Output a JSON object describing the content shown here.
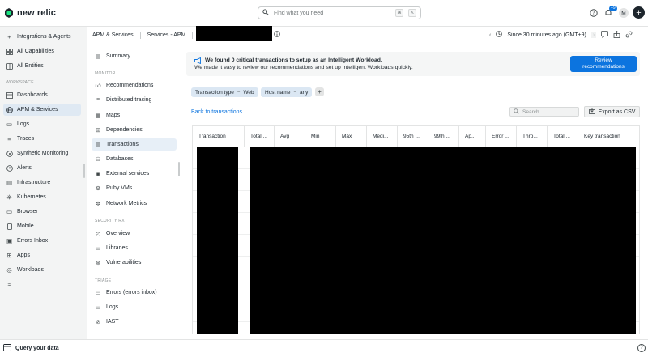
{
  "brand": {
    "name": "new relic",
    "accent": "#1ce783",
    "primary": "#0c74df"
  },
  "header": {
    "search_placeholder": "Find what you need",
    "shortcut_cmd": "⌘",
    "shortcut_key": "K",
    "notifications_badge": "+9",
    "avatar_initial": "M"
  },
  "sidebar": {
    "top_items": [
      {
        "label": "Integrations & Agents",
        "icon": "plus-icon"
      },
      {
        "label": "All Capabilities",
        "icon": "grid-icon"
      },
      {
        "label": "All Entities",
        "icon": "entities-icon"
      }
    ],
    "workspace_label": "WORKSPACE",
    "workspace_items": [
      {
        "label": "Dashboards",
        "icon": "dashboard-icon"
      },
      {
        "label": "APM & Services",
        "icon": "globe-icon",
        "active": true
      },
      {
        "label": "Logs",
        "icon": "logs-icon"
      },
      {
        "label": "Traces",
        "icon": "traces-icon"
      },
      {
        "label": "Synthetic Monitoring",
        "icon": "synthetic-icon"
      },
      {
        "label": "Alerts",
        "icon": "bell-icon"
      },
      {
        "label": "Infrastructure",
        "icon": "server-icon"
      },
      {
        "label": "Kubernetes",
        "icon": "kubernetes-icon"
      },
      {
        "label": "Browser",
        "icon": "browser-icon"
      },
      {
        "label": "Mobile",
        "icon": "mobile-icon"
      },
      {
        "label": "Errors Inbox",
        "icon": "inbox-icon"
      },
      {
        "label": "Apps",
        "icon": "apps-icon"
      },
      {
        "label": "Workloads",
        "icon": "workloads-icon"
      }
    ]
  },
  "breadcrumb": {
    "first": "APM & Services",
    "second": "Services - APM"
  },
  "timepicker": {
    "label": "Since 30 minutes ago (GMT+9)"
  },
  "subnav": {
    "summary": "Summary",
    "monitor_label": "MONITOR",
    "monitor_items": [
      {
        "label": "Recommendations",
        "icon": "thumbs-up-icon"
      },
      {
        "label": "Distributed tracing",
        "icon": "tracing-icon"
      },
      {
        "label": "Maps",
        "icon": "map-icon"
      },
      {
        "label": "Dependencies",
        "icon": "dependencies-icon"
      },
      {
        "label": "Transactions",
        "icon": "transactions-icon",
        "active": true
      },
      {
        "label": "Databases",
        "icon": "database-icon"
      },
      {
        "label": "External services",
        "icon": "external-icon"
      },
      {
        "label": "Ruby VMs",
        "icon": "ruby-icon"
      },
      {
        "label": "Network Metrics",
        "icon": "network-icon"
      }
    ],
    "security_label": "SECURITY RX",
    "security_items": [
      {
        "label": "Overview",
        "icon": "overview-icon"
      },
      {
        "label": "Libraries",
        "icon": "library-icon"
      },
      {
        "label": "Vulnerabilities",
        "icon": "vulnerability-icon"
      }
    ],
    "triage_label": "TRIAGE",
    "triage_items": [
      {
        "label": "Errors (errors inbox)",
        "icon": "error-icon"
      },
      {
        "label": "Logs",
        "icon": "logs-icon"
      },
      {
        "label": "IAST",
        "icon": "iast-icon"
      }
    ]
  },
  "banner": {
    "title": "We found 0 critical transactions to setup as an Intelligent Workload.",
    "text": "We made it easy to review our recommendations and set up Intelligent Workloads quickly.",
    "button_line1": "Review",
    "button_line2": "recommendations"
  },
  "filters": [
    {
      "key": "Transaction type",
      "op": "=",
      "value": "Web"
    },
    {
      "key": "Host name",
      "op": "=",
      "value": "any"
    }
  ],
  "table": {
    "back_link": "Back to transactions",
    "search_placeholder": "Search",
    "export_label": "Export as CSV",
    "columns": [
      "Transaction",
      "Total ...",
      "Avg",
      "Min",
      "Max",
      "Medi...",
      "95th ...",
      "99th ...",
      "Ap...",
      "Error ...",
      "Thro...",
      "Total ...",
      "Key transaction"
    ]
  },
  "bottombar": {
    "query_label": "Query your data"
  }
}
